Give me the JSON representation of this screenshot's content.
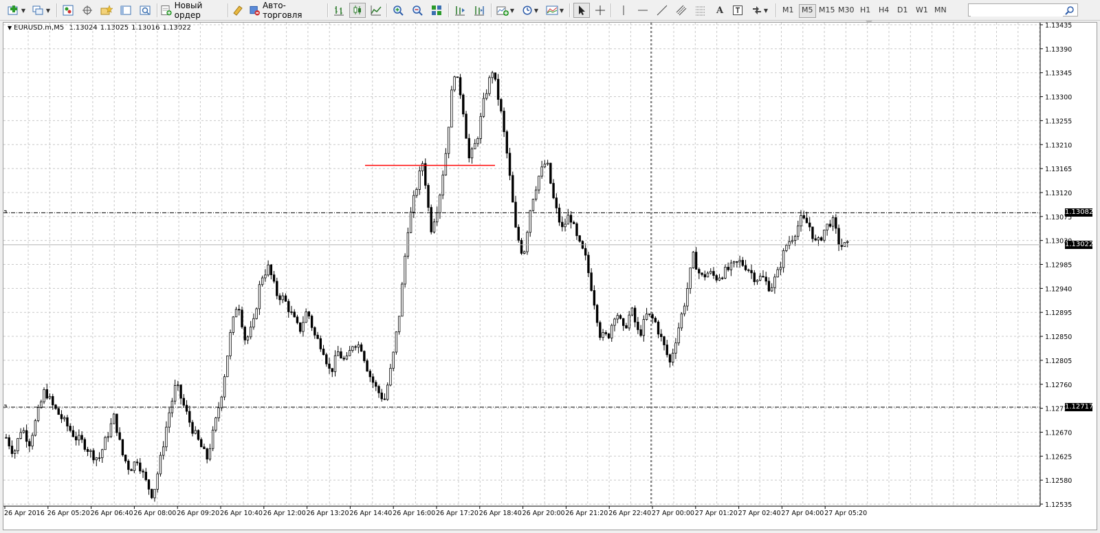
{
  "toolbar": {
    "new_order_label": "Новый ордер",
    "autotrading_label": "Авто-торговля",
    "timeframes": [
      "M1",
      "M5",
      "M15",
      "M30",
      "H1",
      "H4",
      "D1",
      "W1",
      "MN"
    ],
    "active_timeframe": "M5",
    "search_placeholder": "",
    "icons": [
      "new-chart-icon",
      "profiles-icon",
      "market-watch-icon",
      "navigator-icon",
      "favorites-icon",
      "data-window-icon",
      "strategy-tester-icon",
      "new-order-icon",
      "metaeditor-icon",
      "autotrading-icon",
      "bar-chart-icon",
      "candlestick-icon",
      "line-chart-icon",
      "zoom-in-icon",
      "zoom-out-icon",
      "tile-windows-icon",
      "chart-shift-icon",
      "auto-scroll-icon",
      "indicators-icon",
      "periods-icon",
      "templates-icon",
      "cursor-icon",
      "crosshair-icon",
      "vertical-line-icon",
      "horizontal-line-icon",
      "trendline-icon",
      "equidistant-channel-icon",
      "fibonacci-icon",
      "text-icon",
      "text-label-icon",
      "arrows-icon",
      "search-icon"
    ]
  },
  "chart": {
    "symbol_info": "EURUSD.m,M5",
    "ohlc": [
      "1.13024",
      "1.13025",
      "1.13016",
      "1.13022"
    ],
    "current_price_label": "1.13022",
    "level_labels": [
      "1.13082",
      "1.12717"
    ],
    "colors": {
      "background": "#ffffff",
      "grid": "#c0c0c0",
      "candle": "#000000",
      "red_line": "#ff0000"
    }
  },
  "chart_data": {
    "type": "candlestick",
    "symbol": "EURUSD.m",
    "timeframe": "M5",
    "y_ticks": [
      "1.13435",
      "1.13390",
      "1.13345",
      "1.13300",
      "1.13255",
      "1.13210",
      "1.13165",
      "1.13120",
      "1.13075",
      "1.13030",
      "1.12985",
      "1.12940",
      "1.12895",
      "1.12850",
      "1.12805",
      "1.12760",
      "1.12715",
      "1.12670",
      "1.12625",
      "1.12580",
      "1.12535"
    ],
    "ylim": [
      1.12535,
      1.13435
    ],
    "x_labels": [
      "26 Apr 2016",
      "26 Apr 05:20",
      "26 Apr 06:40",
      "26 Apr 08:00",
      "26 Apr 09:20",
      "26 Apr 10:40",
      "26 Apr 12:00",
      "26 Apr 13:20",
      "26 Apr 14:40",
      "26 Apr 16:00",
      "26 Apr 17:20",
      "26 Apr 18:40",
      "26 Apr 20:00",
      "26 Apr 21:20",
      "26 Apr 22:40",
      "27 Apr 00:00",
      "27 Apr 01:20",
      "27 Apr 02:40",
      "27 Apr 04:00",
      "27 Apr 05:20"
    ],
    "close_path": [
      1.1266,
      1.1263,
      1.1268,
      1.1265,
      1.127,
      1.1275,
      1.1272,
      1.127,
      1.1268,
      1.1266,
      1.1265,
      1.1263,
      1.1262,
      1.1266,
      1.127,
      1.1263,
      1.126,
      1.1262,
      1.1258,
      1.1255,
      1.1262,
      1.127,
      1.1276,
      1.1272,
      1.1268,
      1.1265,
      1.1262,
      1.1268,
      1.1275,
      1.1285,
      1.1292,
      1.1284,
      1.1287,
      1.1296,
      1.1298,
      1.1293,
      1.1292,
      1.1289,
      1.1286,
      1.129,
      1.1285,
      1.1283,
      1.1278,
      1.1282,
      1.128,
      1.1284,
      1.1283,
      1.1278,
      1.1275,
      1.1273,
      1.128,
      1.129,
      1.1305,
      1.1312,
      1.1318,
      1.1305,
      1.131,
      1.132,
      1.1335,
      1.133,
      1.1318,
      1.1322,
      1.133,
      1.1335,
      1.1328,
      1.1318,
      1.1305,
      1.13,
      1.131,
      1.1315,
      1.1318,
      1.131,
      1.1305,
      1.1308,
      1.1303,
      1.13,
      1.1293,
      1.1285,
      1.1285,
      1.129,
      1.1286,
      1.129,
      1.1285,
      1.1289,
      1.1288,
      1.1284,
      1.128,
      1.1286,
      1.1292,
      1.13,
      1.1296,
      1.1297,
      1.1296,
      1.1297,
      1.1298,
      1.1299,
      1.1298,
      1.1296,
      1.1296,
      1.1294,
      1.1297,
      1.1302,
      1.1304,
      1.1307,
      1.1306,
      1.1302,
      1.1305,
      1.1307,
      1.1302,
      1.1302
    ],
    "horizontal_levels": [
      1.13082,
      1.12717
    ],
    "current_price": 1.13022,
    "red_line_level": 1.13171,
    "crosshair_time": "27 Apr 00:00",
    "grid": true
  }
}
